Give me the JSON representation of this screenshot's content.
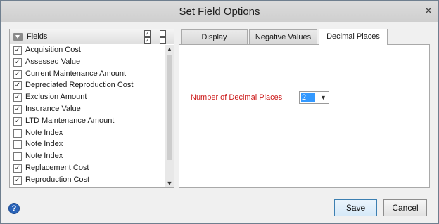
{
  "window": {
    "title": "Set Field Options",
    "close_glyph": "✕"
  },
  "fields_panel": {
    "header_label": "Fields",
    "check_glyph": "✓",
    "scroll_up_glyph": "▲",
    "scroll_down_glyph": "▼",
    "items": [
      {
        "label": "Acquisition Cost",
        "checked": true
      },
      {
        "label": "Assessed Value",
        "checked": true
      },
      {
        "label": "Current Maintenance Amount",
        "checked": true
      },
      {
        "label": "Depreciated Reproduction Cost",
        "checked": true
      },
      {
        "label": "Exclusion Amount",
        "checked": true
      },
      {
        "label": "Insurance Value",
        "checked": true
      },
      {
        "label": "LTD Maintenance Amount",
        "checked": true
      },
      {
        "label": "Note Index",
        "checked": false
      },
      {
        "label": "Note Index",
        "checked": false
      },
      {
        "label": "Note Index",
        "checked": false
      },
      {
        "label": "Replacement Cost",
        "checked": true
      },
      {
        "label": "Reproduction Cost",
        "checked": true
      }
    ]
  },
  "tabs": {
    "display_label": "Display",
    "negative_label": "Negative Values",
    "decimal_label": "Decimal Places",
    "active": "Decimal Places"
  },
  "decimal_places": {
    "label": "Number of Decimal Places",
    "value": "2",
    "dropdown_glyph": "▼",
    "label_color": "#cc1a1a"
  },
  "footer": {
    "help_glyph": "?",
    "save_label": "Save",
    "cancel_label": "Cancel"
  }
}
